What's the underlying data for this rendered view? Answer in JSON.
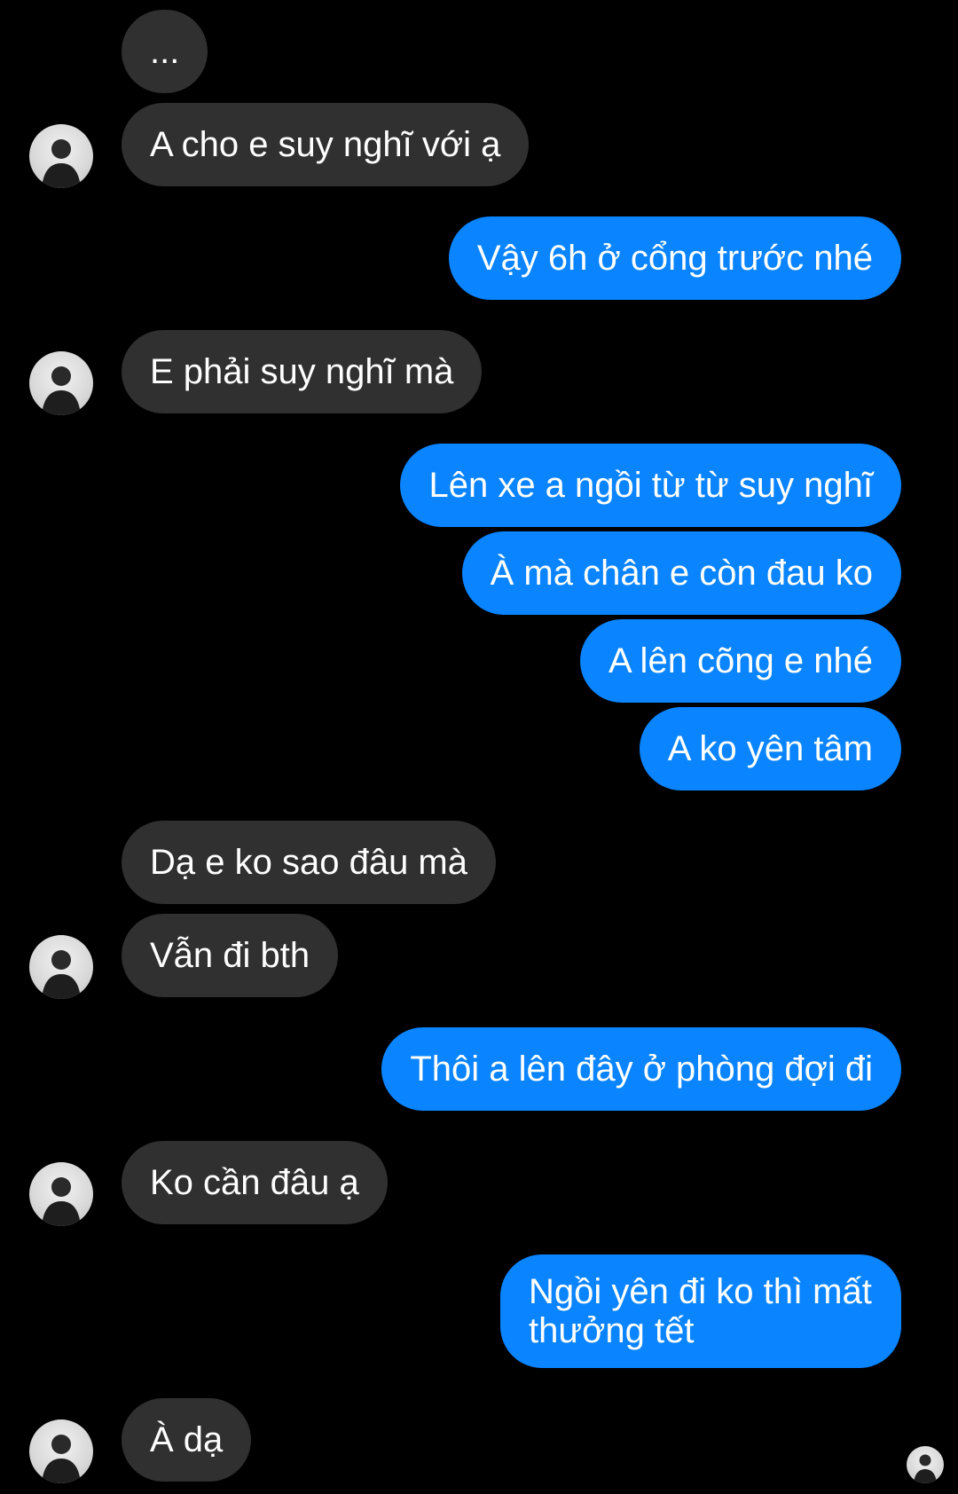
{
  "conversation": {
    "messages": [
      {
        "id": "m1",
        "side": "in",
        "text": "..."
      },
      {
        "id": "m2",
        "side": "in",
        "text": "A cho e suy nghĩ với ạ"
      },
      {
        "id": "m3",
        "side": "out",
        "text": "Vậy 6h ở cổng trước nhé"
      },
      {
        "id": "m4",
        "side": "in",
        "text": "E phải suy nghĩ mà"
      },
      {
        "id": "m5",
        "side": "out",
        "text": "Lên xe a ngồi từ từ suy nghĩ"
      },
      {
        "id": "m6",
        "side": "out",
        "text": "À mà chân e còn đau ko"
      },
      {
        "id": "m7",
        "side": "out",
        "text": "A lên cõng e nhé"
      },
      {
        "id": "m8",
        "side": "out",
        "text": "A ko yên tâm"
      },
      {
        "id": "m9",
        "side": "in",
        "text": "Dạ e ko sao đâu mà"
      },
      {
        "id": "m10",
        "side": "in",
        "text": "Vẫn đi bth"
      },
      {
        "id": "m11",
        "side": "out",
        "text": "Thôi a lên đây ở phòng đợi đi"
      },
      {
        "id": "m12",
        "side": "in",
        "text": "Ko cần đâu ạ"
      },
      {
        "id": "m13",
        "side": "out",
        "text": "Ngồi yên đi ko thì mất thưởng tết"
      },
      {
        "id": "m14",
        "side": "in",
        "text": "À dạ"
      }
    ]
  },
  "colors": {
    "background": "#000000",
    "incoming_bubble": "#303030",
    "outgoing_bubble": "#0a84ff",
    "text": "#ffffff"
  },
  "icons": {
    "contact_avatar": "avatar-photo",
    "read_receipt": "seen-avatar"
  }
}
